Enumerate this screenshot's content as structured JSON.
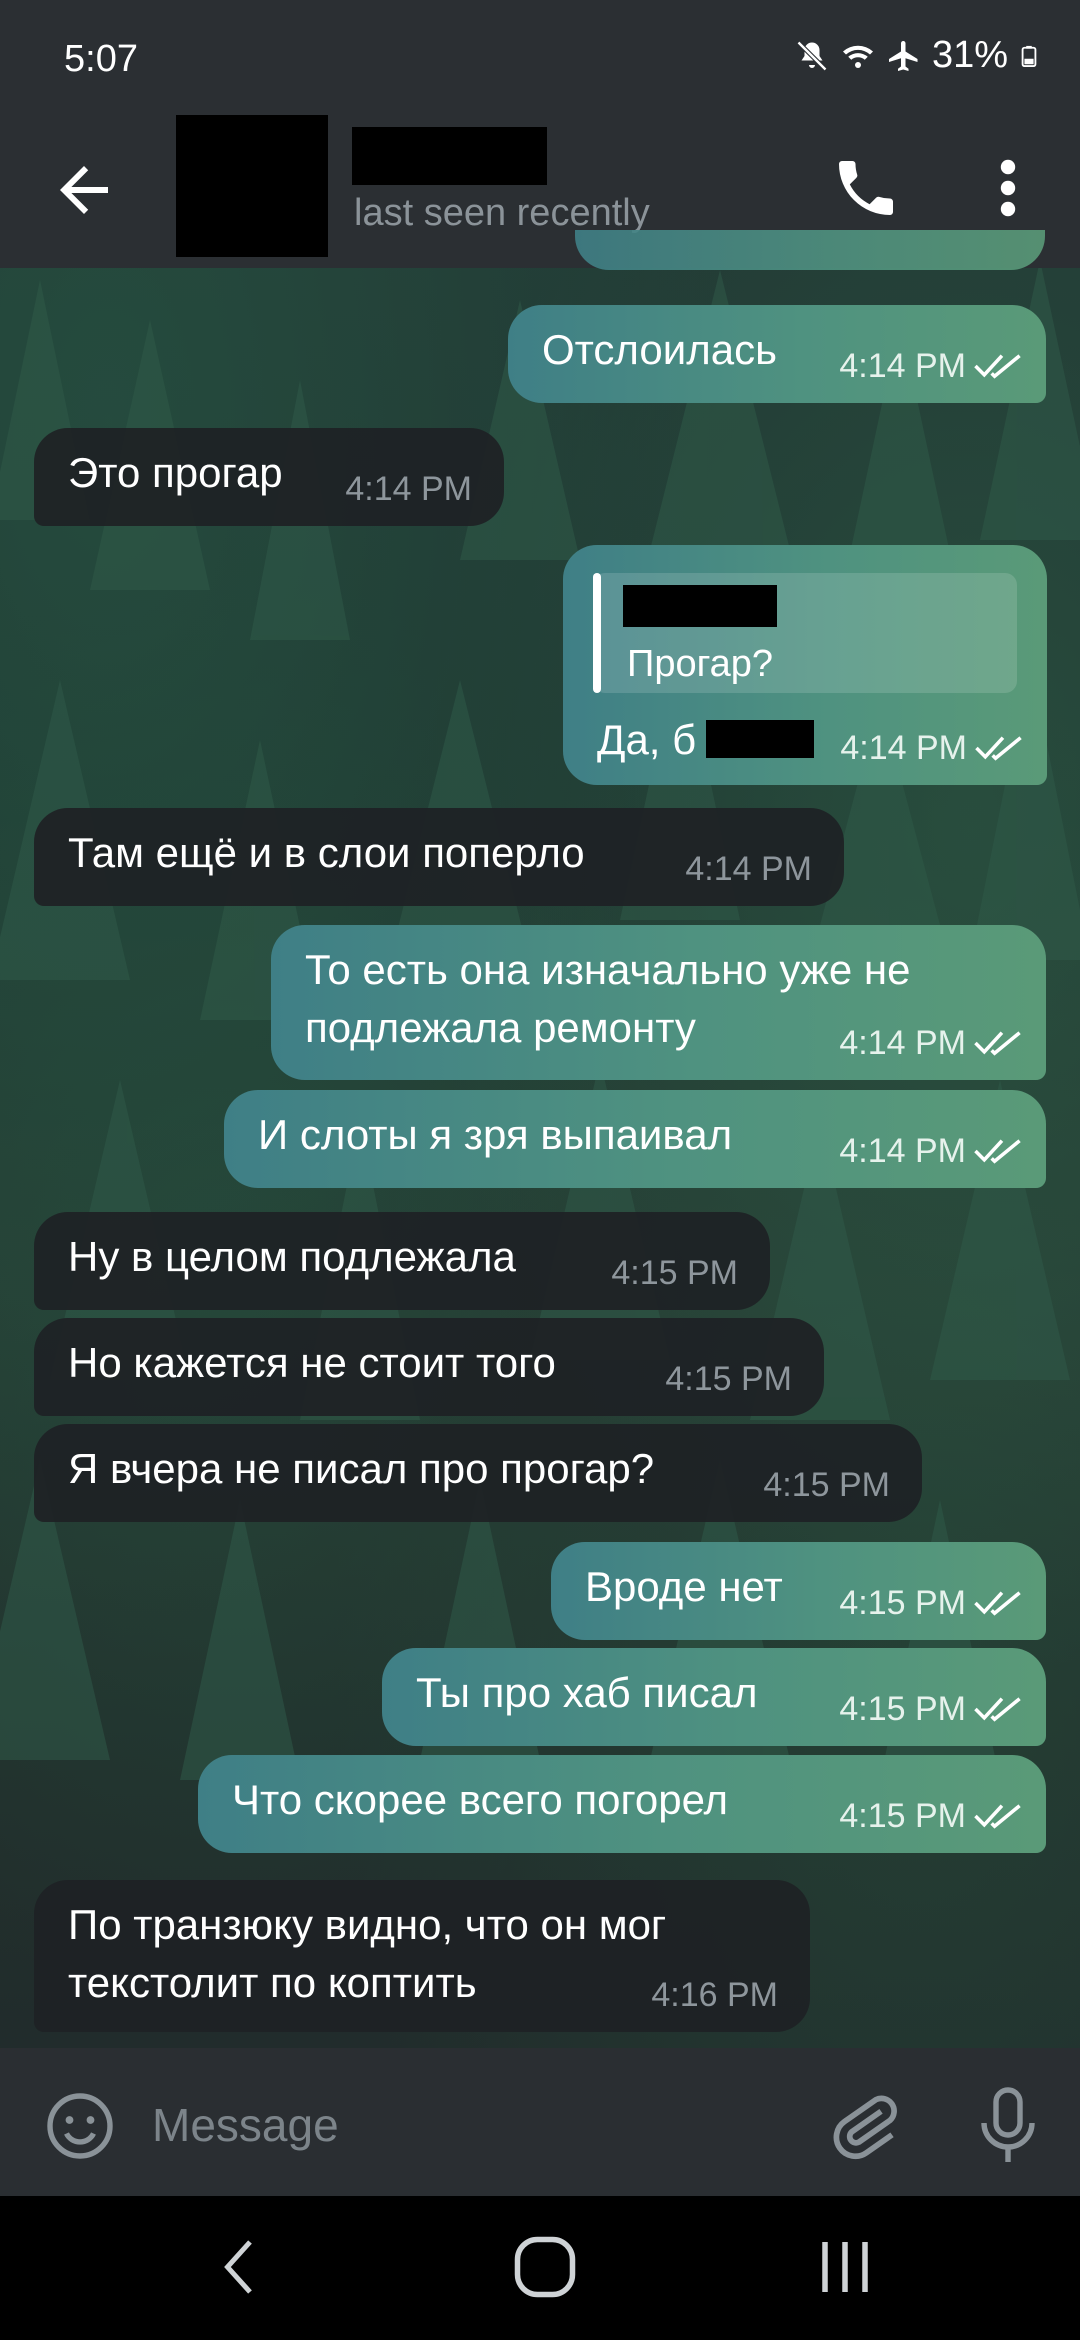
{
  "status_bar": {
    "time": "5:07",
    "battery": "31%",
    "icons": [
      "mute-icon",
      "wifi-icon",
      "airplane-icon",
      "battery-icon"
    ]
  },
  "header": {
    "contact_status": "last seen recently",
    "icons": [
      "back-arrow-icon",
      "phone-icon",
      "more-vert-icon"
    ]
  },
  "messages": [
    {
      "dir": "out",
      "text": "Отслоилась",
      "time": "4:14 PM"
    },
    {
      "dir": "in",
      "text": "Это прогар",
      "time": "4:14 PM"
    },
    {
      "dir": "out",
      "reply_text": "Прогар?",
      "text": "Да, б",
      "time": "4:14 PM"
    },
    {
      "dir": "in",
      "text": "Там ещё и в слои поперло",
      "time": "4:14 PM"
    },
    {
      "dir": "out",
      "text": "То есть она изначально уже не\nподлежала ремонту",
      "time": "4:14 PM"
    },
    {
      "dir": "out",
      "text": "И слоты я зря выпаивал",
      "time": "4:14 PM"
    },
    {
      "dir": "in",
      "text": "Ну в целом подлежала",
      "time": "4:15 PM"
    },
    {
      "dir": "in",
      "text": "Но кажется не стоит того",
      "time": "4:15 PM"
    },
    {
      "dir": "in",
      "text": "Я вчера не писал про прогар?",
      "time": "4:15 PM"
    },
    {
      "dir": "out",
      "text": "Вроде нет",
      "time": "4:15 PM"
    },
    {
      "dir": "out",
      "text": "Ты про хаб писал",
      "time": "4:15 PM"
    },
    {
      "dir": "out",
      "text": "Что скорее всего погорел",
      "time": "4:15 PM"
    },
    {
      "dir": "in",
      "text": "По транзюку видно, что он мог\nтекстолит по коптить",
      "time": "4:16 PM"
    }
  ],
  "input": {
    "placeholder": "Message",
    "icons": [
      "emoji-icon",
      "attach-icon",
      "mic-icon"
    ]
  },
  "nav": {
    "icons": [
      "nav-back-icon",
      "nav-home-icon",
      "nav-recent-icon"
    ]
  },
  "colors": {
    "incoming_bubble": "#1e2125",
    "outgoing_bubble_start": "#3f7f86",
    "outgoing_bubble_end": "#5a9a78",
    "header_bg": "#2b2f33",
    "secondary_text": "#8e969c"
  }
}
